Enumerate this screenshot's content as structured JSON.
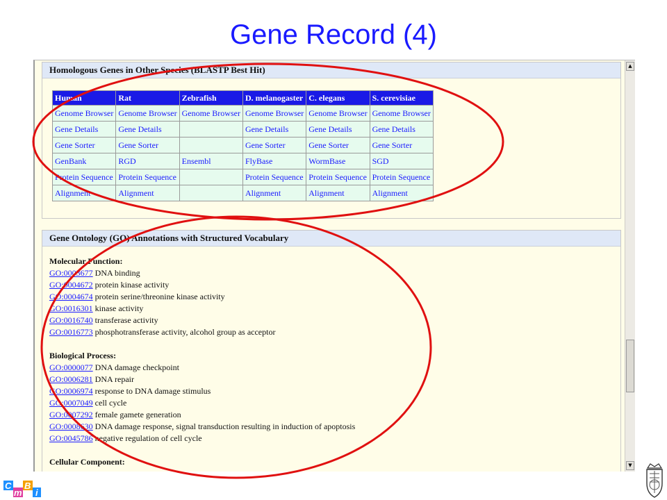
{
  "slide": {
    "title": "Gene Record (4)"
  },
  "homologs": {
    "heading": "Homologous Genes in Other Species (BLASTP Best Hit)",
    "columns": [
      "Human",
      "Rat",
      "Zebrafish",
      "D. melanogaster",
      "C. elegans",
      "S. cerevisiae"
    ],
    "rows": [
      [
        "Genome Browser",
        "Genome Browser",
        "Genome Browser",
        "Genome Browser",
        "Genome Browser",
        "Genome Browser"
      ],
      [
        "Gene Details",
        "Gene Details",
        "",
        "Gene Details",
        "Gene Details",
        "Gene Details"
      ],
      [
        "Gene Sorter",
        "Gene Sorter",
        "",
        "Gene Sorter",
        "Gene Sorter",
        "Gene Sorter"
      ],
      [
        "GenBank",
        "RGD",
        "Ensembl",
        "FlyBase",
        "WormBase",
        "SGD"
      ],
      [
        "Protein Sequence",
        "Protein Sequence",
        "",
        "Protein Sequence",
        "Protein Sequence",
        "Protein Sequence"
      ],
      [
        "Alignment",
        "Alignment",
        "",
        "Alignment",
        "Alignment",
        "Alignment"
      ]
    ]
  },
  "go": {
    "heading": "Gene Ontology (GO) Annotations with Structured Vocabulary",
    "molecular_function": {
      "title": "Molecular Function:",
      "items": [
        {
          "id": "GO:0003677",
          "label": "DNA binding"
        },
        {
          "id": "GO:0004672",
          "label": "protein kinase activity"
        },
        {
          "id": "GO:0004674",
          "label": "protein serine/threonine kinase activity"
        },
        {
          "id": "GO:0016301",
          "label": "kinase activity"
        },
        {
          "id": "GO:0016740",
          "label": "transferase activity"
        },
        {
          "id": "GO:0016773",
          "label": "phosphotransferase activity, alcohol group as acceptor"
        }
      ]
    },
    "biological_process": {
      "title": "Biological Process:",
      "items": [
        {
          "id": "GO:0000077",
          "label": "DNA damage checkpoint"
        },
        {
          "id": "GO:0006281",
          "label": "DNA repair"
        },
        {
          "id": "GO:0006974",
          "label": "response to DNA damage stimulus"
        },
        {
          "id": "GO:0007049",
          "label": "cell cycle"
        },
        {
          "id": "GO:0007292",
          "label": "female gamete generation"
        },
        {
          "id": "GO:0008630",
          "label": "DNA damage response, signal transduction resulting in induction of apoptosis"
        },
        {
          "id": "GO:0045786",
          "label": "negative regulation of cell cycle"
        }
      ]
    },
    "cellular_component": {
      "title": "Cellular Component:"
    }
  },
  "logo": {
    "letters": [
      "C",
      "m",
      "B",
      "i"
    ]
  },
  "colors": {
    "title": "#1a1aff",
    "link": "#1a1aff",
    "table_header": "#1a1ae6",
    "table_cell": "#e6fbee",
    "annotation_ellipse": "#e01010"
  }
}
